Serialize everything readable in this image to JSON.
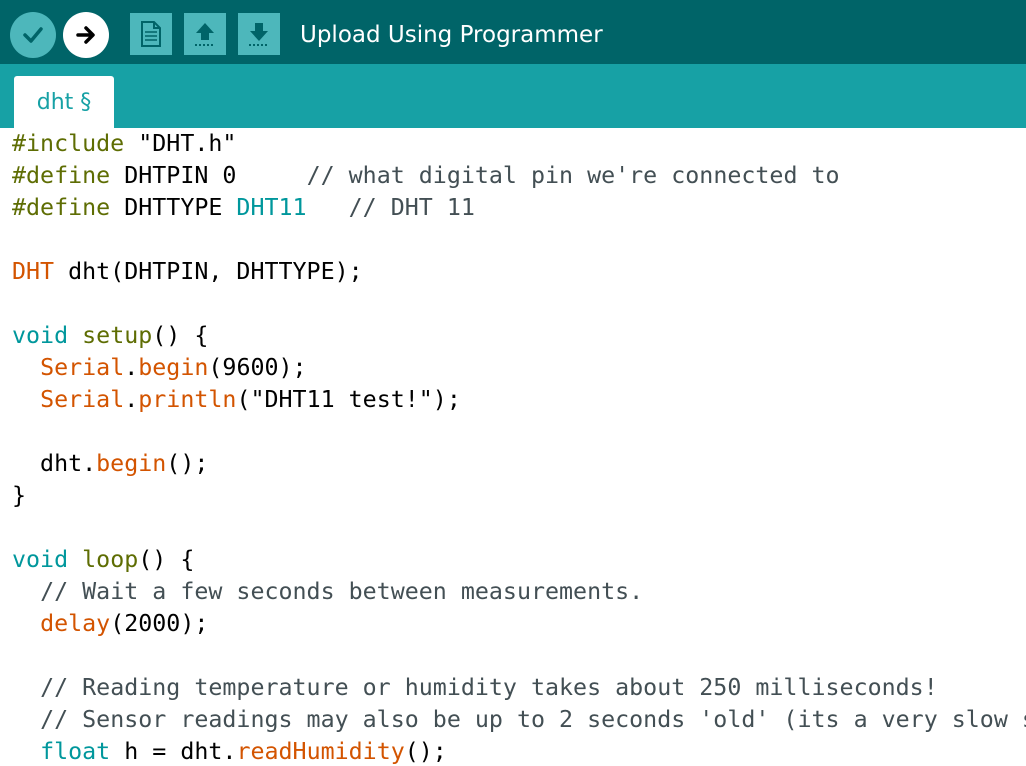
{
  "toolbar": {
    "status": "Upload Using Programmer",
    "buttons": [
      {
        "name": "verify",
        "icon": "checkmark-icon"
      },
      {
        "name": "upload",
        "icon": "right-arrow-icon"
      },
      {
        "name": "new",
        "icon": "document-icon"
      },
      {
        "name": "open",
        "icon": "up-arrow-icon"
      },
      {
        "name": "save",
        "icon": "down-arrow-icon"
      }
    ]
  },
  "tab": {
    "label": "dht §"
  },
  "colors": {
    "toolbar_bg": "#006468",
    "tabbar_bg": "#17a1a5",
    "button_bg": "#4db7bb",
    "preprocessor": "#5e6d03",
    "keyword": "#00979c",
    "function": "#d35400",
    "comment": "#434f54",
    "text": "#000000"
  },
  "code": [
    [
      [
        "pp",
        "#include"
      ],
      [
        "t",
        " \"DHT.h\""
      ]
    ],
    [
      [
        "pp",
        "#define"
      ],
      [
        "t",
        " DHTPIN 0     "
      ],
      [
        "c",
        "// what digital pin we're connected to"
      ]
    ],
    [
      [
        "pp",
        "#define"
      ],
      [
        "t",
        " DHTTYPE "
      ],
      [
        "kw",
        "DHT11"
      ],
      [
        "t",
        "   "
      ],
      [
        "c",
        "// DHT 11"
      ]
    ],
    [],
    [
      [
        "fn",
        "DHT"
      ],
      [
        "t",
        " dht(DHTPIN, DHTTYPE);"
      ]
    ],
    [],
    [
      [
        "kw",
        "void"
      ],
      [
        "t",
        " "
      ],
      [
        "pp",
        "setup"
      ],
      [
        "t",
        "() {"
      ]
    ],
    [
      [
        "t",
        "  "
      ],
      [
        "fn",
        "Serial"
      ],
      [
        "t",
        "."
      ],
      [
        "fn",
        "begin"
      ],
      [
        "t",
        "(9600);"
      ]
    ],
    [
      [
        "t",
        "  "
      ],
      [
        "fn",
        "Serial"
      ],
      [
        "t",
        "."
      ],
      [
        "fn",
        "println"
      ],
      [
        "t",
        "(\"DHT11 test!\");"
      ]
    ],
    [],
    [
      [
        "t",
        "  dht."
      ],
      [
        "fn",
        "begin"
      ],
      [
        "t",
        "();"
      ]
    ],
    [
      [
        "t",
        "}"
      ]
    ],
    [],
    [
      [
        "kw",
        "void"
      ],
      [
        "t",
        " "
      ],
      [
        "pp",
        "loop"
      ],
      [
        "t",
        "() {"
      ]
    ],
    [
      [
        "t",
        "  "
      ],
      [
        "c",
        "// Wait a few seconds between measurements."
      ]
    ],
    [
      [
        "t",
        "  "
      ],
      [
        "fn",
        "delay"
      ],
      [
        "t",
        "(2000);"
      ]
    ],
    [],
    [
      [
        "t",
        "  "
      ],
      [
        "c",
        "// Reading temperature or humidity takes about 250 milliseconds!"
      ]
    ],
    [
      [
        "t",
        "  "
      ],
      [
        "c",
        "// Sensor readings may also be up to 2 seconds 'old' (its a very slow s"
      ]
    ],
    [
      [
        "t",
        "  "
      ],
      [
        "kw",
        "float"
      ],
      [
        "t",
        " h = dht."
      ],
      [
        "fn",
        "readHumidity"
      ],
      [
        "t",
        "();"
      ]
    ]
  ]
}
